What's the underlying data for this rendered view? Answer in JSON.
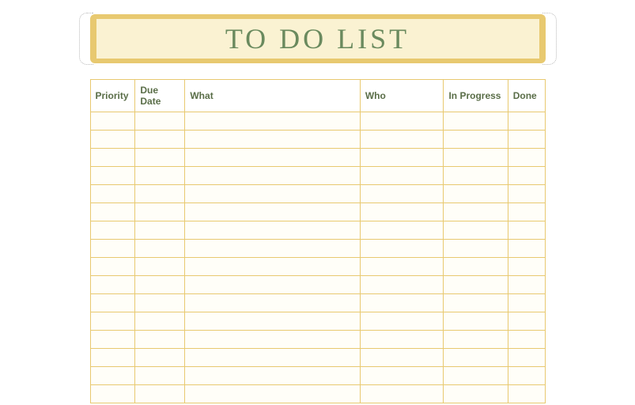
{
  "title": "TO DO LIST",
  "columns": {
    "priority": "Priority",
    "due_date": "Due Date",
    "what": "What",
    "who": "Who",
    "in_progress": "In Progress",
    "done": "Done"
  },
  "rows": [
    {
      "priority": "",
      "due_date": "",
      "what": "",
      "who": "",
      "in_progress": "",
      "done": ""
    },
    {
      "priority": "",
      "due_date": "",
      "what": "",
      "who": "",
      "in_progress": "",
      "done": ""
    },
    {
      "priority": "",
      "due_date": "",
      "what": "",
      "who": "",
      "in_progress": "",
      "done": ""
    },
    {
      "priority": "",
      "due_date": "",
      "what": "",
      "who": "",
      "in_progress": "",
      "done": ""
    },
    {
      "priority": "",
      "due_date": "",
      "what": "",
      "who": "",
      "in_progress": "",
      "done": ""
    },
    {
      "priority": "",
      "due_date": "",
      "what": "",
      "who": "",
      "in_progress": "",
      "done": ""
    },
    {
      "priority": "",
      "due_date": "",
      "what": "",
      "who": "",
      "in_progress": "",
      "done": ""
    },
    {
      "priority": "",
      "due_date": "",
      "what": "",
      "who": "",
      "in_progress": "",
      "done": ""
    },
    {
      "priority": "",
      "due_date": "",
      "what": "",
      "who": "",
      "in_progress": "",
      "done": ""
    },
    {
      "priority": "",
      "due_date": "",
      "what": "",
      "who": "",
      "in_progress": "",
      "done": ""
    },
    {
      "priority": "",
      "due_date": "",
      "what": "",
      "who": "",
      "in_progress": "",
      "done": ""
    },
    {
      "priority": "",
      "due_date": "",
      "what": "",
      "who": "",
      "in_progress": "",
      "done": ""
    },
    {
      "priority": "",
      "due_date": "",
      "what": "",
      "who": "",
      "in_progress": "",
      "done": ""
    },
    {
      "priority": "",
      "due_date": "",
      "what": "",
      "who": "",
      "in_progress": "",
      "done": ""
    },
    {
      "priority": "",
      "due_date": "",
      "what": "",
      "who": "",
      "in_progress": "",
      "done": ""
    },
    {
      "priority": "",
      "due_date": "",
      "what": "",
      "who": "",
      "in_progress": "",
      "done": ""
    }
  ]
}
